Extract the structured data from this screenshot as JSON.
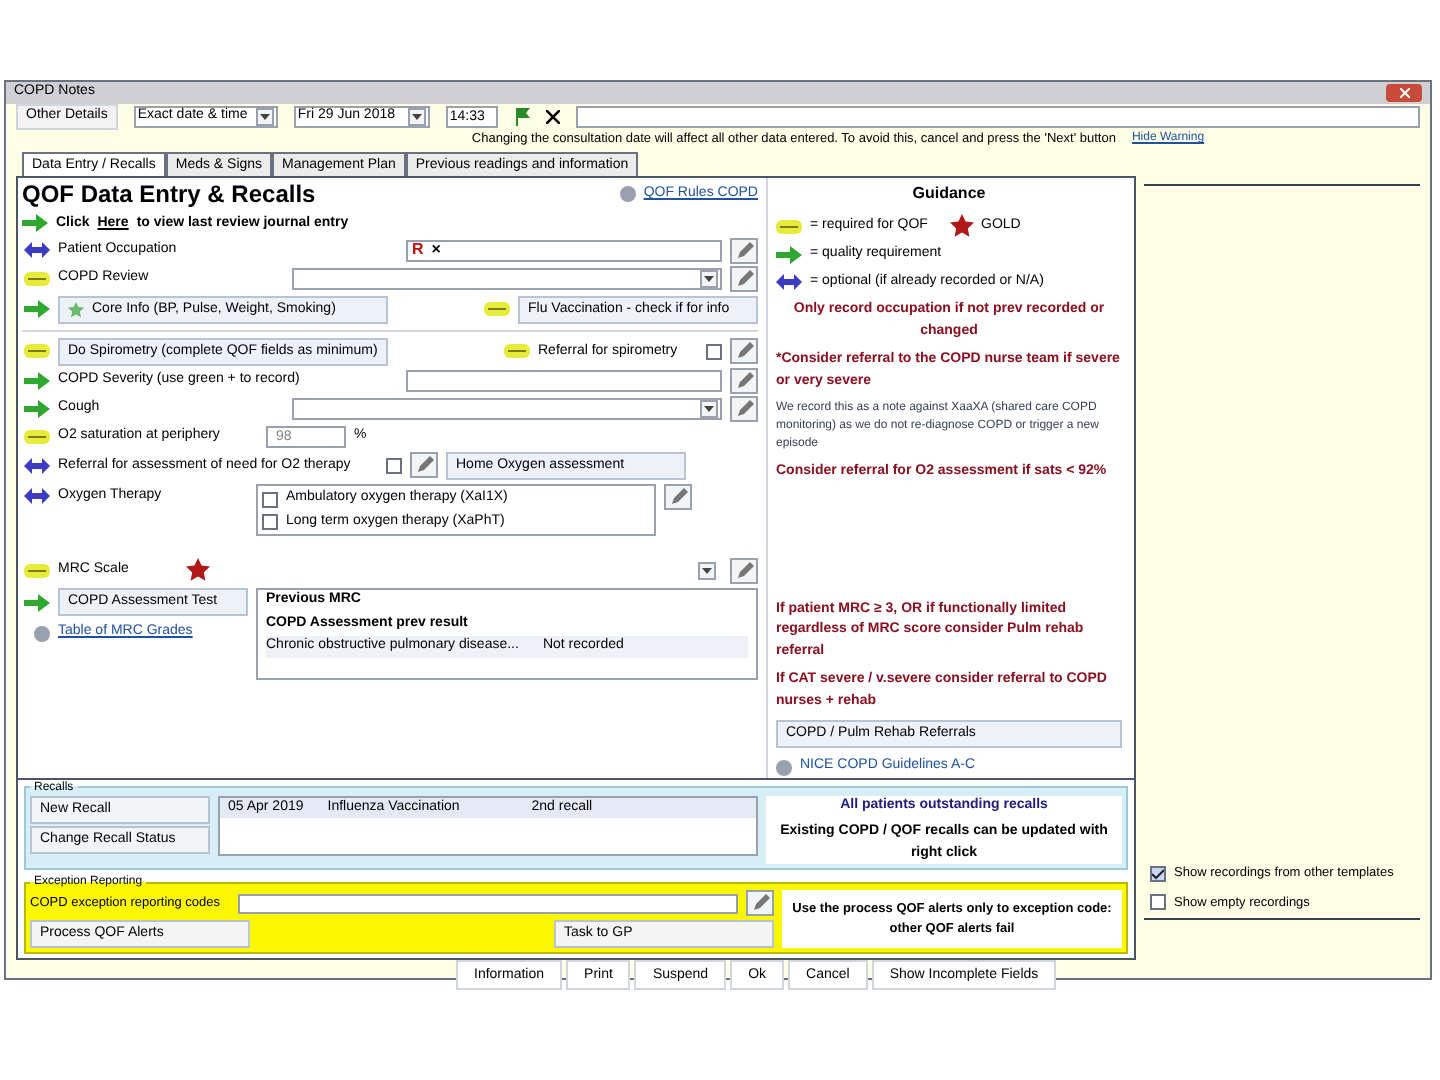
{
  "window": {
    "title": "COPD Notes"
  },
  "toolbar": {
    "details_button": "Other Details",
    "date_mode": "Exact date & time",
    "date": "Fri 29 Jun 2018",
    "time": "14:33"
  },
  "warning": {
    "text": "Changing the consultation date will affect all other data entered. To avoid this, cancel and press the 'Next' button",
    "link": "Hide Warning"
  },
  "tabs": [
    {
      "label": "Data Entry / Recalls",
      "selected": true
    },
    {
      "label": "Meds & Signs",
      "selected": false
    },
    {
      "label": "Management Plan",
      "selected": false
    },
    {
      "label": "Previous readings and information",
      "selected": false
    }
  ],
  "heading": "QOF Data Entry & Recalls",
  "rules_link": "QOF Rules COPD",
  "rows": [
    {
      "kind": "link_line",
      "marker": {
        "kind": "quality"
      },
      "before": "Click",
      "link": "Here",
      "after": "to view last review journal entry"
    },
    {
      "kind": "text_field",
      "marker": {
        "kind": "optional"
      },
      "label": "Patient Occupation",
      "codes": [
        "R",
        "×"
      ]
    },
    {
      "kind": "select_field",
      "marker": {
        "kind": "qof"
      },
      "label": "COPD Review"
    },
    {
      "kind": "buttons",
      "marker": {
        "kind": "quality"
      },
      "button": "Core Info (BP, Pulse, Weight, Smoking)",
      "marker2": {
        "kind": "qof"
      },
      "button2": "Flu Vaccination - check if for info"
    },
    {
      "kind": "divider"
    },
    {
      "kind": "button_check",
      "marker": {
        "kind": "qof"
      },
      "button": "Do Spirometry (complete QOF fields as minimum)",
      "marker2": {
        "kind": "qof"
      },
      "label2": "Referral for spirometry",
      "checked": false
    },
    {
      "kind": "text_field",
      "marker": {
        "kind": "quality"
      },
      "label": "COPD Severity (use green + to record)"
    },
    {
      "kind": "select_field",
      "marker": {
        "kind": "quality"
      },
      "label": "Cough"
    },
    {
      "kind": "percent_field",
      "marker": {
        "kind": "qof"
      },
      "label": "O2 saturation at periphery",
      "placeholder": "98",
      "unit": "%"
    },
    {
      "kind": "check_button",
      "marker": {
        "kind": "optional"
      },
      "label": "Referral for assessment of need for O2 therapy",
      "checked": false,
      "button": "Home Oxygen assessment"
    },
    {
      "kind": "checklist",
      "marker": {
        "kind": "optional"
      },
      "label": "Oxygen Therapy",
      "options": [
        {
          "label": "Ambulatory oxygen therapy (XaI1X)",
          "checked": false
        },
        {
          "label": "Long term oxygen therapy (XaPhT)",
          "checked": false
        }
      ]
    },
    {
      "kind": "mrc",
      "marker": {
        "kind": "qof"
      },
      "label": "MRC Scale",
      "button": "COPD Assessment Test",
      "link": "Table of MRC Grades",
      "previous": {
        "title": "Previous MRC",
        "subtitle": "COPD Assessment prev result",
        "item": "Chronic obstructive pulmonary disease...",
        "status": "Not recorded"
      }
    }
  ],
  "guidance": {
    "title": "Guidance",
    "legend": [
      {
        "kind": "qof",
        "text": "= required for QOF"
      },
      {
        "kind": "star",
        "text": "GOLD"
      },
      {
        "kind": "quality",
        "text": "= quality requirement"
      },
      {
        "kind": "optional",
        "text": "= optional (if already recorded or N/A)"
      }
    ],
    "notes": [
      {
        "kind": "alert",
        "text": "Only record occupation if not prev recorded or changed"
      },
      {
        "kind": "alert_left",
        "text": "*Consider referral to the COPD nurse team if severe or very severe"
      },
      {
        "kind": "small",
        "text": "We record this as a note against XaaXA (shared care COPD monitoring) as we do not re-diagnose COPD or trigger a new episode"
      },
      {
        "kind": "alert_left",
        "text": "Consider referral for O2 assessment if sats < 92%"
      },
      {
        "kind": "gap"
      },
      {
        "kind": "alert_left",
        "text": "If patient MRC ≥ 3, OR if functionally limited regardless of MRC score consider Pulm rehab referral"
      },
      {
        "kind": "alert_left",
        "text": "If CAT severe / v.severe consider referral to COPD nurses + rehab"
      },
      {
        "kind": "button",
        "text": "COPD / Pulm Rehab Referrals"
      },
      {
        "kind": "link",
        "text": "NICE COPD Guidelines A-C"
      }
    ]
  },
  "recalls": {
    "legend": "Recalls",
    "buttons": [
      "New Recall",
      "Change Recall Status"
    ],
    "rows": [
      {
        "date": "05 Apr 2019",
        "name": "Influenza Vaccination",
        "status": "2nd recall"
      }
    ],
    "link": "All patients outstanding recalls",
    "note": "Existing COPD / QOF recalls can be updated with right click"
  },
  "exception": {
    "legend": "Exception Reporting",
    "label": "COPD exception reporting codes",
    "alerts_button": "Process QOF Alerts",
    "task_button": "Task to GP",
    "note": "Use the process QOF alerts only to exception code: other QOF alerts fail"
  },
  "side_options": [
    {
      "label": "Show recordings from other templates",
      "checked": true
    },
    {
      "label": "Show empty recordings",
      "checked": false
    }
  ],
  "footer_buttons": [
    "Information",
    "Print",
    "Suspend",
    "Ok",
    "Cancel",
    "Show Incomplete Fields"
  ]
}
